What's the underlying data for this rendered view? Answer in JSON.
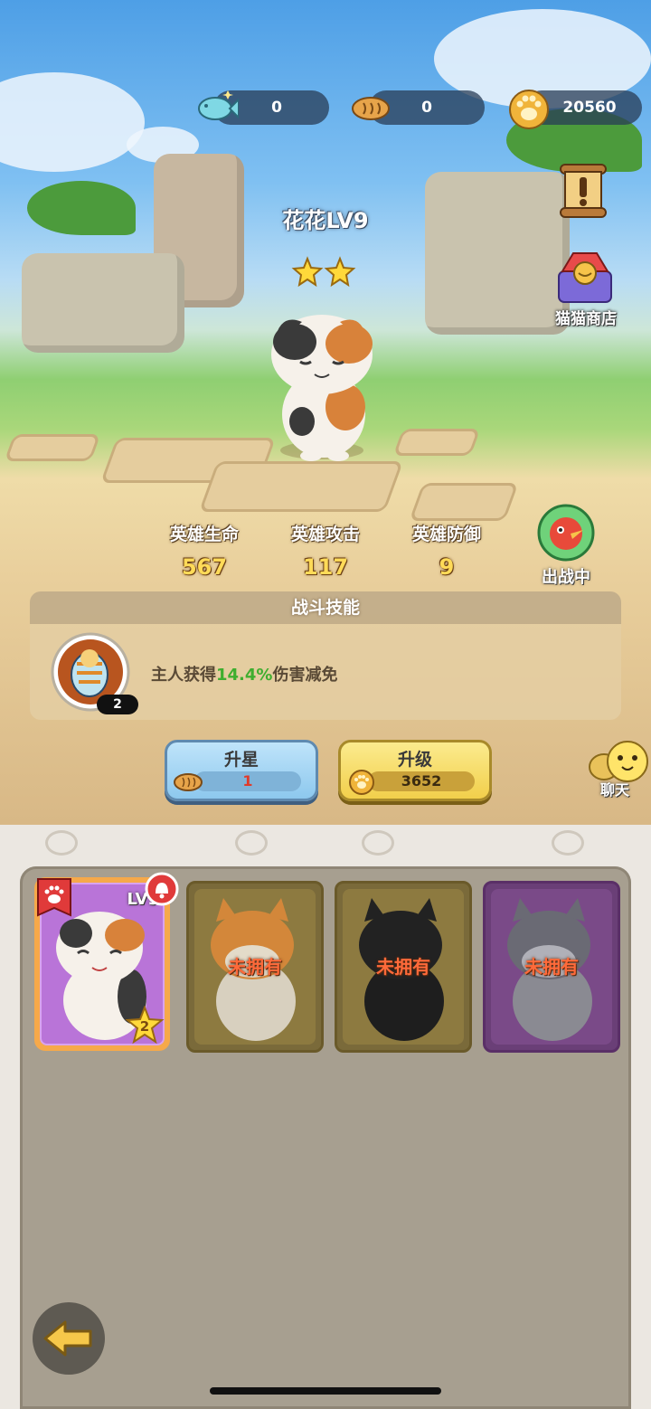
{
  "resources": {
    "fish": {
      "icon": "fish-currency-icon",
      "value": "0"
    },
    "biscuit": {
      "icon": "fish-biscuit-icon",
      "value": "0"
    },
    "paw": {
      "icon": "paw-coin-icon",
      "value": "20560"
    }
  },
  "side": {
    "quest_icon": "quest-scroll-icon",
    "shop_label": "猫猫商店"
  },
  "hero": {
    "name": "花花LV9",
    "stars": 2,
    "stats": [
      {
        "label": "英雄生命",
        "value": "567"
      },
      {
        "label": "英雄攻击",
        "value": "117"
      },
      {
        "label": "英雄防御",
        "value": "9"
      }
    ],
    "deploy_label": "出战中"
  },
  "skill": {
    "title": "战斗技能",
    "badge": "2",
    "text_prefix": "主人获得",
    "text_highlight": "14.4%",
    "text_suffix": "伤害减免"
  },
  "buttons": {
    "star_up": {
      "title": "升星",
      "value": "1"
    },
    "level_up": {
      "title": "升级",
      "value": "3652"
    }
  },
  "chat": {
    "label": "聊天"
  },
  "cards": [
    {
      "level": "LV9",
      "star_badge": "2",
      "owned": true,
      "selected": true
    },
    {
      "status": "未拥有",
      "owned": false
    },
    {
      "status": "未拥有",
      "owned": false
    },
    {
      "status": "未拥有",
      "owned": false
    }
  ],
  "colors": {
    "accent_gold": "#ffdb58",
    "highlight_green": "#3fae2f",
    "unowned_orange": "#ff6a3a"
  }
}
